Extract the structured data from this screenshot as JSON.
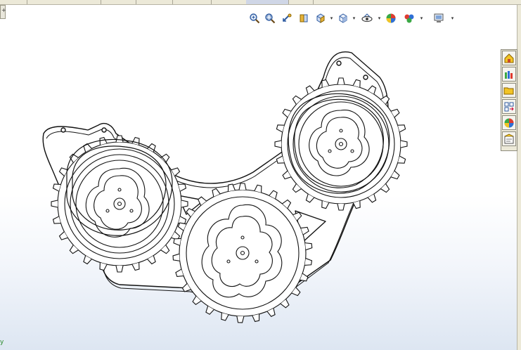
{
  "window": {
    "tab_label": "",
    "corner_button_label": "+",
    "axis_label": "y"
  },
  "heads_up_toolbar": {
    "tools": [
      {
        "name": "zoom-to-fit-icon",
        "has_dropdown": false
      },
      {
        "name": "zoom-to-area-icon",
        "has_dropdown": false
      },
      {
        "name": "previous-view-icon",
        "has_dropdown": false
      },
      {
        "name": "section-view-icon",
        "has_dropdown": false
      },
      {
        "name": "view-orientation-icon",
        "has_dropdown": true
      },
      {
        "name": "display-style-icon",
        "has_dropdown": true
      },
      {
        "name": "hide-show-items-icon",
        "has_dropdown": true
      },
      {
        "name": "edit-appearance-icon",
        "has_dropdown": false
      },
      {
        "name": "apply-scene-icon",
        "has_dropdown": true
      },
      {
        "name": "view-settings-icon",
        "has_dropdown": true
      }
    ]
  },
  "task_pane": {
    "buttons": [
      {
        "name": "solidworks-resources-icon"
      },
      {
        "name": "design-library-icon"
      },
      {
        "name": "file-explorer-icon"
      },
      {
        "name": "view-palette-icon"
      },
      {
        "name": "appearances-scenes-icon"
      },
      {
        "name": "custom-properties-icon"
      }
    ]
  },
  "colors": {
    "background_top": "#ffffff",
    "background_bottom": "#dde6f2",
    "line": "#111111",
    "task_pane_bg": "#ece9d8"
  },
  "model": {
    "description_visible": false
  }
}
